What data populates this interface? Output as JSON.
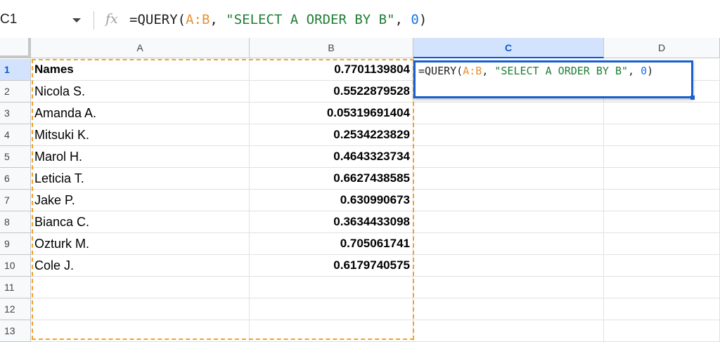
{
  "formula_bar": {
    "cell_ref": "C1",
    "fx_label": "fx",
    "formula": {
      "prefix": "=QUERY(",
      "range": "A:B",
      "comma1": ", ",
      "string": "\"SELECT A ORDER BY B\"",
      "comma2": ", ",
      "number": "0",
      "suffix": ")"
    }
  },
  "columns": [
    "A",
    "B",
    "C",
    "D"
  ],
  "selected_column": "C",
  "selected_row": "1",
  "rows": [
    {
      "num": "1",
      "a": "Names",
      "b": "0.7701139804"
    },
    {
      "num": "2",
      "a": "Nicola S.",
      "b": "0.5522879528"
    },
    {
      "num": "3",
      "a": "Amanda A.",
      "b": "0.05319691404"
    },
    {
      "num": "4",
      "a": "Mitsuki K.",
      "b": "0.2534223829"
    },
    {
      "num": "5",
      "a": "Marol H.",
      "b": "0.4643323734"
    },
    {
      "num": "6",
      "a": "Leticia T.",
      "b": "0.6627438585"
    },
    {
      "num": "7",
      "a": "Jake P.",
      "b": "0.630990673"
    },
    {
      "num": "8",
      "a": "Bianca C.",
      "b": "0.3634433098"
    },
    {
      "num": "9",
      "a": "Ozturk M.",
      "b": "0.705061741"
    },
    {
      "num": "10",
      "a": "Cole J.",
      "b": "0.6179740575"
    },
    {
      "num": "11",
      "a": "",
      "b": ""
    },
    {
      "num": "12",
      "a": "",
      "b": ""
    },
    {
      "num": "13",
      "a": "",
      "b": ""
    }
  ],
  "colors": {
    "range_highlight": "#f0a030",
    "active_cell_border": "#1a5fd0",
    "header_selected_bg": "#d3e3fd"
  }
}
